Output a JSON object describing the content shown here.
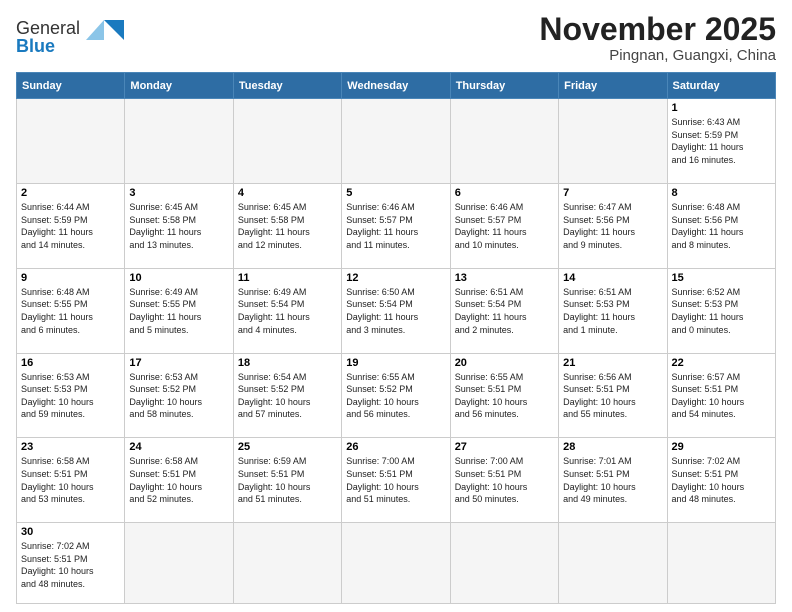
{
  "header": {
    "logo_general": "General",
    "logo_blue": "Blue",
    "month_title": "November 2025",
    "location": "Pingnan, Guangxi, China"
  },
  "days_of_week": [
    "Sunday",
    "Monday",
    "Tuesday",
    "Wednesday",
    "Thursday",
    "Friday",
    "Saturday"
  ],
  "weeks": [
    [
      {
        "day": null,
        "info": null
      },
      {
        "day": null,
        "info": null
      },
      {
        "day": null,
        "info": null
      },
      {
        "day": null,
        "info": null
      },
      {
        "day": null,
        "info": null
      },
      {
        "day": null,
        "info": null
      },
      {
        "day": "1",
        "info": "Sunrise: 6:43 AM\nSunset: 5:59 PM\nDaylight: 11 hours\nand 16 minutes."
      }
    ],
    [
      {
        "day": "2",
        "info": "Sunrise: 6:44 AM\nSunset: 5:59 PM\nDaylight: 11 hours\nand 14 minutes."
      },
      {
        "day": "3",
        "info": "Sunrise: 6:45 AM\nSunset: 5:58 PM\nDaylight: 11 hours\nand 13 minutes."
      },
      {
        "day": "4",
        "info": "Sunrise: 6:45 AM\nSunset: 5:58 PM\nDaylight: 11 hours\nand 12 minutes."
      },
      {
        "day": "5",
        "info": "Sunrise: 6:46 AM\nSunset: 5:57 PM\nDaylight: 11 hours\nand 11 minutes."
      },
      {
        "day": "6",
        "info": "Sunrise: 6:46 AM\nSunset: 5:57 PM\nDaylight: 11 hours\nand 10 minutes."
      },
      {
        "day": "7",
        "info": "Sunrise: 6:47 AM\nSunset: 5:56 PM\nDaylight: 11 hours\nand 9 minutes."
      },
      {
        "day": "8",
        "info": "Sunrise: 6:48 AM\nSunset: 5:56 PM\nDaylight: 11 hours\nand 8 minutes."
      }
    ],
    [
      {
        "day": "9",
        "info": "Sunrise: 6:48 AM\nSunset: 5:55 PM\nDaylight: 11 hours\nand 6 minutes."
      },
      {
        "day": "10",
        "info": "Sunrise: 6:49 AM\nSunset: 5:55 PM\nDaylight: 11 hours\nand 5 minutes."
      },
      {
        "day": "11",
        "info": "Sunrise: 6:49 AM\nSunset: 5:54 PM\nDaylight: 11 hours\nand 4 minutes."
      },
      {
        "day": "12",
        "info": "Sunrise: 6:50 AM\nSunset: 5:54 PM\nDaylight: 11 hours\nand 3 minutes."
      },
      {
        "day": "13",
        "info": "Sunrise: 6:51 AM\nSunset: 5:54 PM\nDaylight: 11 hours\nand 2 minutes."
      },
      {
        "day": "14",
        "info": "Sunrise: 6:51 AM\nSunset: 5:53 PM\nDaylight: 11 hours\nand 1 minute."
      },
      {
        "day": "15",
        "info": "Sunrise: 6:52 AM\nSunset: 5:53 PM\nDaylight: 11 hours\nand 0 minutes."
      }
    ],
    [
      {
        "day": "16",
        "info": "Sunrise: 6:53 AM\nSunset: 5:53 PM\nDaylight: 10 hours\nand 59 minutes."
      },
      {
        "day": "17",
        "info": "Sunrise: 6:53 AM\nSunset: 5:52 PM\nDaylight: 10 hours\nand 58 minutes."
      },
      {
        "day": "18",
        "info": "Sunrise: 6:54 AM\nSunset: 5:52 PM\nDaylight: 10 hours\nand 57 minutes."
      },
      {
        "day": "19",
        "info": "Sunrise: 6:55 AM\nSunset: 5:52 PM\nDaylight: 10 hours\nand 56 minutes."
      },
      {
        "day": "20",
        "info": "Sunrise: 6:55 AM\nSunset: 5:51 PM\nDaylight: 10 hours\nand 56 minutes."
      },
      {
        "day": "21",
        "info": "Sunrise: 6:56 AM\nSunset: 5:51 PM\nDaylight: 10 hours\nand 55 minutes."
      },
      {
        "day": "22",
        "info": "Sunrise: 6:57 AM\nSunset: 5:51 PM\nDaylight: 10 hours\nand 54 minutes."
      }
    ],
    [
      {
        "day": "23",
        "info": "Sunrise: 6:58 AM\nSunset: 5:51 PM\nDaylight: 10 hours\nand 53 minutes."
      },
      {
        "day": "24",
        "info": "Sunrise: 6:58 AM\nSunset: 5:51 PM\nDaylight: 10 hours\nand 52 minutes."
      },
      {
        "day": "25",
        "info": "Sunrise: 6:59 AM\nSunset: 5:51 PM\nDaylight: 10 hours\nand 51 minutes."
      },
      {
        "day": "26",
        "info": "Sunrise: 7:00 AM\nSunset: 5:51 PM\nDaylight: 10 hours\nand 51 minutes."
      },
      {
        "day": "27",
        "info": "Sunrise: 7:00 AM\nSunset: 5:51 PM\nDaylight: 10 hours\nand 50 minutes."
      },
      {
        "day": "28",
        "info": "Sunrise: 7:01 AM\nSunset: 5:51 PM\nDaylight: 10 hours\nand 49 minutes."
      },
      {
        "day": "29",
        "info": "Sunrise: 7:02 AM\nSunset: 5:51 PM\nDaylight: 10 hours\nand 48 minutes."
      }
    ],
    [
      {
        "day": "30",
        "info": "Sunrise: 7:02 AM\nSunset: 5:51 PM\nDaylight: 10 hours\nand 48 minutes."
      },
      {
        "day": null,
        "info": null
      },
      {
        "day": null,
        "info": null
      },
      {
        "day": null,
        "info": null
      },
      {
        "day": null,
        "info": null
      },
      {
        "day": null,
        "info": null
      },
      {
        "day": null,
        "info": null
      }
    ]
  ]
}
